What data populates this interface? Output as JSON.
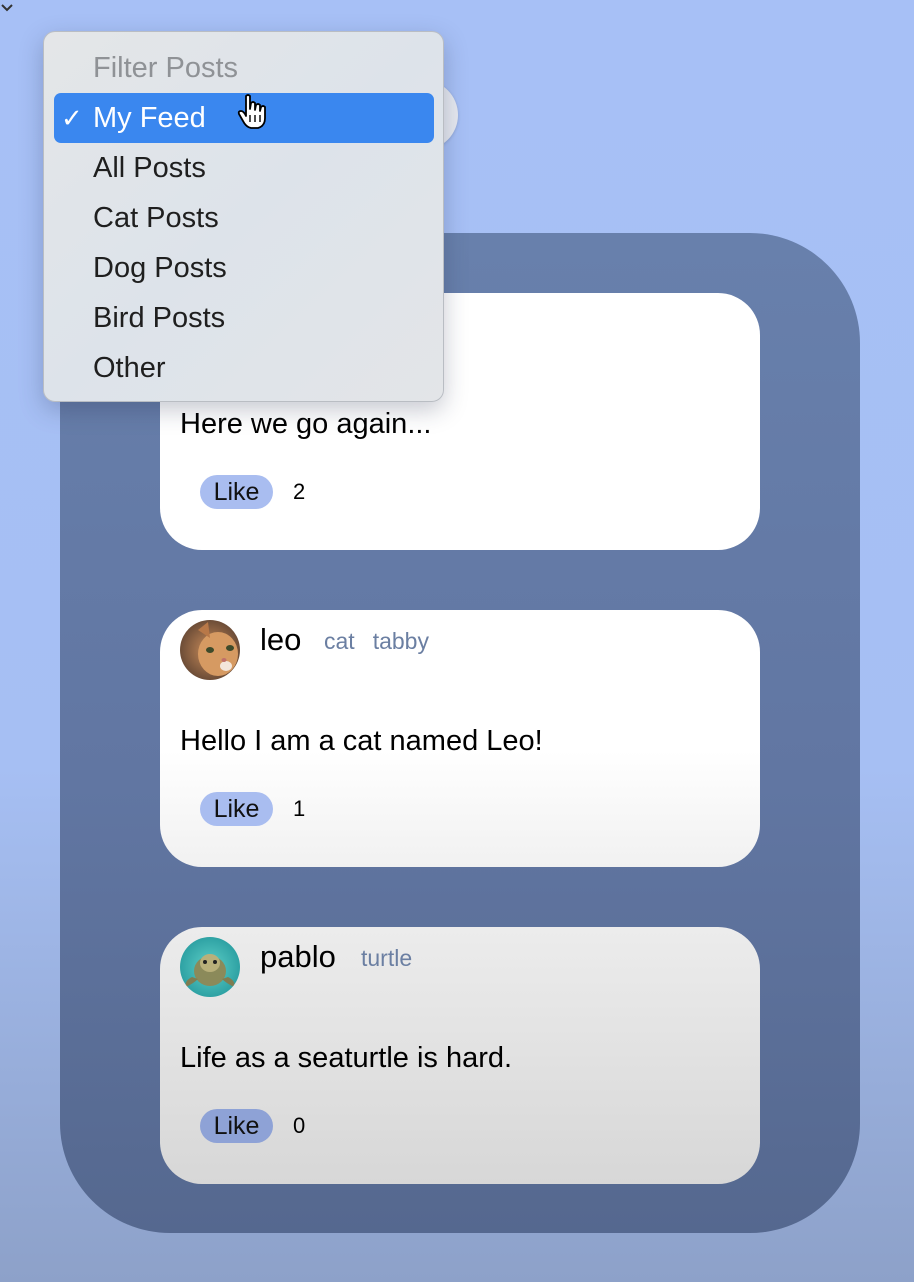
{
  "filter_menu": {
    "header": "Filter Posts",
    "checkmark": "✓",
    "items": [
      {
        "label": "My Feed",
        "selected": true
      },
      {
        "label": "All Posts",
        "selected": false
      },
      {
        "label": "Cat Posts",
        "selected": false
      },
      {
        "label": "Dog Posts",
        "selected": false
      },
      {
        "label": "Bird Posts",
        "selected": false
      },
      {
        "label": "Other",
        "selected": false
      }
    ],
    "highlight_color": "#3a87ef"
  },
  "posts": [
    {
      "text": "Here we go again...",
      "like_label": "Like",
      "likes": "2"
    },
    {
      "username": "leo",
      "tags": [
        "cat",
        "tabby"
      ],
      "avatar": "cat-avatar",
      "text": "Hello I am a cat named Leo!",
      "like_label": "Like",
      "likes": "1"
    },
    {
      "username": "pablo",
      "tags": [
        "turtle"
      ],
      "avatar": "turtle-avatar",
      "text": "Life as a seaturtle is hard.",
      "like_label": "Like",
      "likes": "0"
    }
  ],
  "colors": {
    "background": "#a7c0f6",
    "panel": "#6880ac",
    "like_button": "#a9bdf0",
    "tag_text": "#6b7fa2"
  }
}
